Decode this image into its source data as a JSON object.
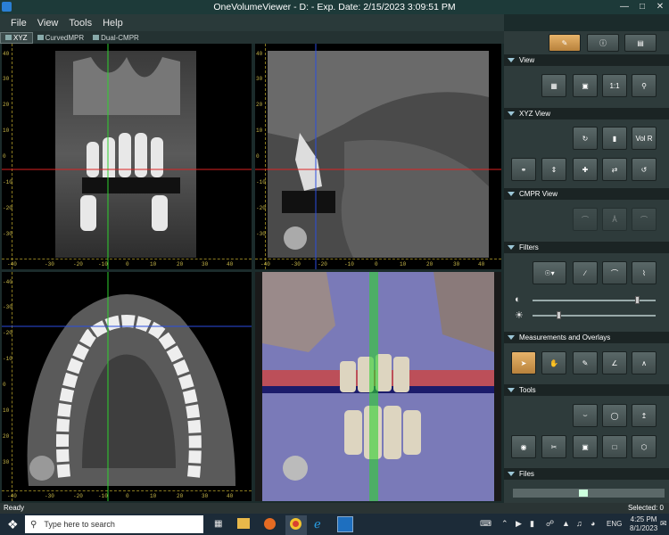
{
  "window": {
    "title": "OneVolumeViewer - D: - Exp. Date: 2/15/2023 3:09:51 PM"
  },
  "menu": [
    "File",
    "View",
    "Tools",
    "Help"
  ],
  "tabs": [
    "XYZ",
    "CurvedMPR",
    "Dual-CMPR"
  ],
  "views": {
    "coronal_ruler_v": [
      "40",
      "30",
      "20",
      "10",
      "0",
      "-10",
      "-20",
      "-30",
      "-40"
    ],
    "coronal_ruler_h": [
      "-40",
      "-30",
      "-20",
      "-10",
      "0",
      "10",
      "20",
      "30",
      "40"
    ],
    "sagittal_ruler_v": [
      "40",
      "30",
      "20",
      "10",
      "0",
      "-10",
      "-20",
      "-30",
      "-40"
    ],
    "sagittal_ruler_h": [
      "-40",
      "-30",
      "-20",
      "-10",
      "0",
      "10",
      "20",
      "30",
      "40"
    ],
    "axial_ruler_v": [
      "-40",
      "-30",
      "-20",
      "-10",
      "0",
      "10",
      "20",
      "30",
      "40"
    ],
    "axial_ruler_h": [
      "-40",
      "-30",
      "-20",
      "-10",
      "0",
      "10",
      "20",
      "30",
      "40"
    ]
  },
  "panel": {
    "view_label": "View",
    "xyz_label": "XYZ View",
    "cmpr_label": "CMPR View",
    "filters_label": "Filters",
    "measure_label": "Measurements and Overlays",
    "tools_label": "Tools",
    "files_label": "Files",
    "vol_r": "Vol R",
    "one_to_one": "1:1"
  },
  "status": {
    "left": "Ready",
    "right": "Selected: 0"
  },
  "taskbar": {
    "search_placeholder": "Type here to search",
    "lang": "ENG",
    "time": "4:25 PM",
    "date": "8/1/2023"
  }
}
